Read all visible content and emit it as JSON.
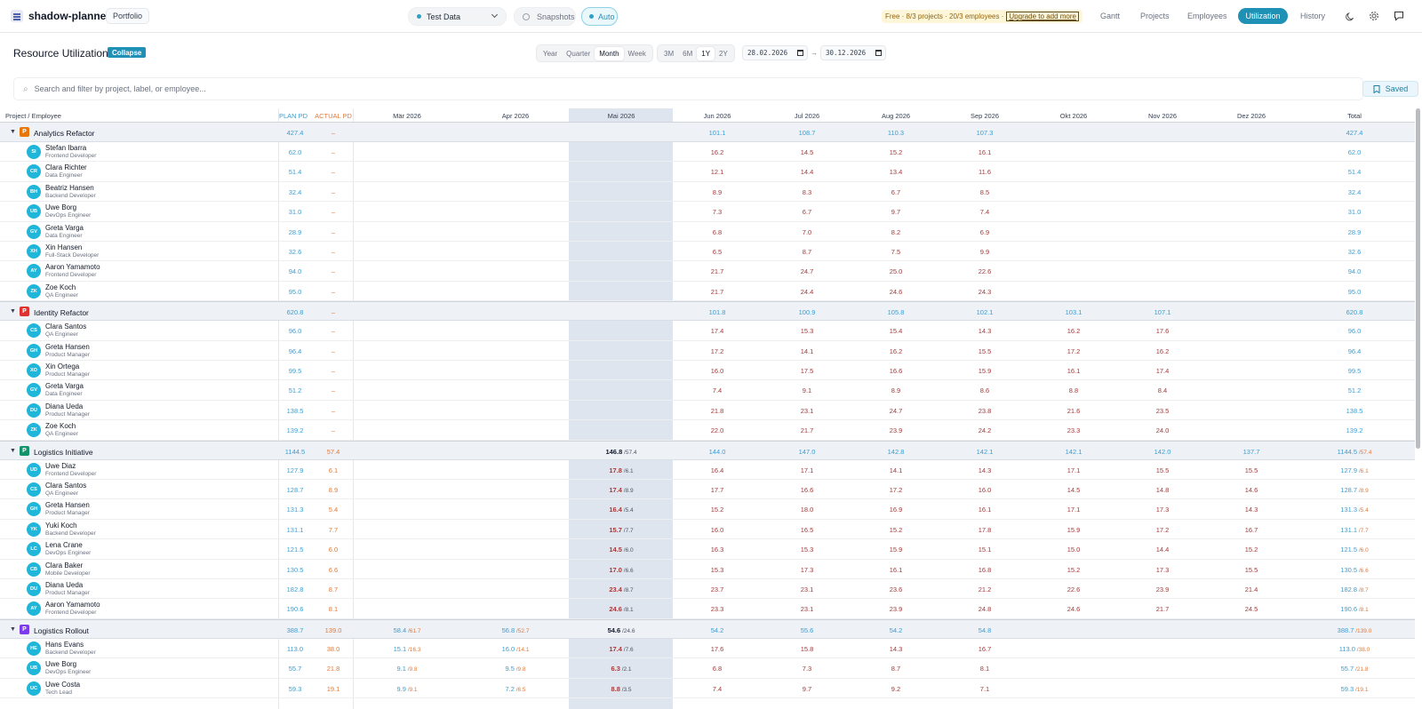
{
  "app": {
    "name": "shadow-planner",
    "portfolio_label": "Portfolio"
  },
  "topbar": {
    "dataset": "Test Data",
    "snapshots": "Snapshots",
    "auto": "Auto",
    "plan_notice": "Free · 8/3 projects · 20/3 employees ·",
    "upgrade": "Upgrade to add more",
    "nav": [
      "Gantt",
      "Projects",
      "Employees",
      "Utilization",
      "History"
    ],
    "active_nav": "Utilization"
  },
  "page": {
    "title": "Resource Utilization",
    "collapse": "Collapse",
    "granularity": [
      "Year",
      "Quarter",
      "Month",
      "Week"
    ],
    "granularity_active": "Month",
    "ranges": [
      "3M",
      "6M",
      "1Y",
      "2Y"
    ],
    "range_active": "1Y",
    "date_from": "28.02.2026",
    "date_to": "30.12.2026",
    "date_arrow": "→",
    "search_placeholder": "Search and filter by project, label, or employee...",
    "saved": "Saved"
  },
  "table": {
    "headers": {
      "name": "Project / Employee",
      "plan": "PLAN PD",
      "actual": "ACTUAL PD",
      "months": [
        "Mär 2026",
        "Apr 2026",
        "Mai 2026",
        "Jun 2026",
        "Jul 2026",
        "Aug 2026",
        "Sep 2026",
        "Okt 2026",
        "Nov 2026",
        "Dez 2026"
      ],
      "total": "Total"
    },
    "colors": {
      "analytics": "#e8760a",
      "identity": "#e03131",
      "logistics_init": "#12936a",
      "logistics_roll": "#7c3aed",
      "avatar": "#1fb6d9"
    },
    "projects": [
      {
        "name": "Analytics Refactor",
        "badge": "P",
        "color": "#e8760a",
        "plan": "427.4",
        "actual": "–",
        "months": [
          "",
          "",
          "",
          "101.1",
          "108.7",
          "110.3",
          "107.3",
          "",
          "",
          ""
        ],
        "total": "427.4",
        "total_actual": "",
        "employees": [
          {
            "initials": "SI",
            "name": "Stefan Ibarra",
            "role": "Frontend Developer",
            "plan": "62.0",
            "actual": "–",
            "months": [
              "",
              "",
              "",
              "16.2",
              "14.5",
              "15.2",
              "16.1",
              "",
              "",
              ""
            ],
            "total": "62.0",
            "total_actual": ""
          },
          {
            "initials": "CR",
            "name": "Clara Richter",
            "role": "Data Engineer",
            "plan": "51.4",
            "actual": "–",
            "months": [
              "",
              "",
              "",
              "12.1",
              "14.4",
              "13.4",
              "11.6",
              "",
              "",
              ""
            ],
            "total": "51.4",
            "total_actual": ""
          },
          {
            "initials": "BH",
            "name": "Beatriz Hansen",
            "role": "Backend Developer",
            "plan": "32.4",
            "actual": "–",
            "months": [
              "",
              "",
              "",
              "8.9",
              "8.3",
              "6.7",
              "8.5",
              "",
              "",
              ""
            ],
            "total": "32.4",
            "total_actual": ""
          },
          {
            "initials": "UB",
            "name": "Uwe Borg",
            "role": "DevOps Engineer",
            "plan": "31.0",
            "actual": "–",
            "months": [
              "",
              "",
              "",
              "7.3",
              "6.7",
              "9.7",
              "7.4",
              "",
              "",
              ""
            ],
            "total": "31.0",
            "total_actual": ""
          },
          {
            "initials": "GV",
            "name": "Greta Varga",
            "role": "Data Engineer",
            "plan": "28.9",
            "actual": "–",
            "months": [
              "",
              "",
              "",
              "6.8",
              "7.0",
              "8.2",
              "6.9",
              "",
              "",
              ""
            ],
            "total": "28.9",
            "total_actual": ""
          },
          {
            "initials": "XH",
            "name": "Xin Hansen",
            "role": "Full-Stack Developer",
            "plan": "32.6",
            "actual": "–",
            "months": [
              "",
              "",
              "",
              "6.5",
              "8.7",
              "7.5",
              "9.9",
              "",
              "",
              ""
            ],
            "total": "32.6",
            "total_actual": ""
          },
          {
            "initials": "AY",
            "name": "Aaron Yamamoto",
            "role": "Frontend Developer",
            "plan": "94.0",
            "actual": "–",
            "months": [
              "",
              "",
              "",
              "21.7",
              "24.7",
              "25.0",
              "22.6",
              "",
              "",
              ""
            ],
            "total": "94.0",
            "total_actual": ""
          },
          {
            "initials": "ZK",
            "name": "Zoe Koch",
            "role": "QA Engineer",
            "plan": "95.0",
            "actual": "–",
            "months": [
              "",
              "",
              "",
              "21.7",
              "24.4",
              "24.6",
              "24.3",
              "",
              "",
              ""
            ],
            "total": "95.0",
            "total_actual": ""
          }
        ]
      },
      {
        "name": "Identity Refactor",
        "badge": "P",
        "color": "#e03131",
        "plan": "620.8",
        "actual": "–",
        "months": [
          "",
          "",
          "",
          "101.8",
          "100.9",
          "105.8",
          "102.1",
          "103.1",
          "107.1",
          ""
        ],
        "total": "620.8",
        "total_actual": "",
        "employees": [
          {
            "initials": "CS",
            "name": "Clara Santos",
            "role": "QA Engineer",
            "plan": "96.0",
            "actual": "–",
            "months": [
              "",
              "",
              "",
              "17.4",
              "15.3",
              "15.4",
              "14.3",
              "16.2",
              "17.6",
              ""
            ],
            "total": "96.0",
            "total_actual": ""
          },
          {
            "initials": "GH",
            "name": "Greta Hansen",
            "role": "Product Manager",
            "plan": "96.4",
            "actual": "–",
            "months": [
              "",
              "",
              "",
              "17.2",
              "14.1",
              "16.2",
              "15.5",
              "17.2",
              "16.2",
              ""
            ],
            "total": "96.4",
            "total_actual": ""
          },
          {
            "initials": "XO",
            "name": "Xin Ortega",
            "role": "Product Manager",
            "plan": "99.5",
            "actual": "–",
            "months": [
              "",
              "",
              "",
              "16.0",
              "17.5",
              "16.6",
              "15.9",
              "16.1",
              "17.4",
              ""
            ],
            "total": "99.5",
            "total_actual": ""
          },
          {
            "initials": "GV",
            "name": "Greta Varga",
            "role": "Data Engineer",
            "plan": "51.2",
            "actual": "–",
            "months": [
              "",
              "",
              "",
              "7.4",
              "9.1",
              "8.9",
              "8.6",
              "8.8",
              "8.4",
              ""
            ],
            "total": "51.2",
            "total_actual": ""
          },
          {
            "initials": "DU",
            "name": "Diana Ueda",
            "role": "Product Manager",
            "plan": "138.5",
            "actual": "–",
            "months": [
              "",
              "",
              "",
              "21.8",
              "23.1",
              "24.7",
              "23.8",
              "21.6",
              "23.5",
              ""
            ],
            "total": "138.5",
            "total_actual": ""
          },
          {
            "initials": "ZK",
            "name": "Zoe Koch",
            "role": "QA Engineer",
            "plan": "139.2",
            "actual": "–",
            "months": [
              "",
              "",
              "",
              "22.0",
              "21.7",
              "23.9",
              "24.2",
              "23.3",
              "24.0",
              ""
            ],
            "total": "139.2",
            "total_actual": ""
          }
        ]
      },
      {
        "name": "Logistics Initiative",
        "badge": "P",
        "color": "#12936a",
        "plan": "1144.5",
        "actual": "57.4",
        "months": [
          "",
          "",
          "146.8|57.4",
          "144.0",
          "147.0",
          "142.8",
          "142.1",
          "142.1",
          "142.0",
          "137.7"
        ],
        "total": "1144.5",
        "total_actual": "57.4",
        "employees": [
          {
            "initials": "UD",
            "name": "Uwe Diaz",
            "role": "Frontend Developer",
            "plan": "127.9",
            "actual": "6.1",
            "months": [
              "",
              "",
              "17.8|6.1",
              "16.4",
              "17.1",
              "14.1",
              "14.3",
              "17.1",
              "15.5",
              "15.5"
            ],
            "total": "127.9",
            "total_actual": "6.1"
          },
          {
            "initials": "CS",
            "name": "Clara Santos",
            "role": "QA Engineer",
            "plan": "128.7",
            "actual": "8.9",
            "months": [
              "",
              "",
              "17.4|8.9",
              "17.7",
              "16.6",
              "17.2",
              "16.0",
              "14.5",
              "14.8",
              "14.6"
            ],
            "total": "128.7",
            "total_actual": "8.9"
          },
          {
            "initials": "GH",
            "name": "Greta Hansen",
            "role": "Product Manager",
            "plan": "131.3",
            "actual": "5.4",
            "months": [
              "",
              "",
              "16.4|5.4",
              "15.2",
              "18.0",
              "16.9",
              "16.1",
              "17.1",
              "17.3",
              "14.3"
            ],
            "total": "131.3",
            "total_actual": "5.4"
          },
          {
            "initials": "YK",
            "name": "Yuki Koch",
            "role": "Backend Developer",
            "plan": "131.1",
            "actual": "7.7",
            "months": [
              "",
              "",
              "15.7|7.7",
              "16.0",
              "16.5",
              "15.2",
              "17.8",
              "15.9",
              "17.2",
              "16.7"
            ],
            "total": "131.1",
            "total_actual": "7.7"
          },
          {
            "initials": "LC",
            "name": "Lena Crane",
            "role": "DevOps Engineer",
            "plan": "121.5",
            "actual": "6.0",
            "months": [
              "",
              "",
              "14.5|6.0",
              "16.3",
              "15.3",
              "15.9",
              "15.1",
              "15.0",
              "14.4",
              "15.2"
            ],
            "total": "121.5",
            "total_actual": "6.0"
          },
          {
            "initials": "CB",
            "name": "Clara Baker",
            "role": "Mobile Developer",
            "plan": "130.5",
            "actual": "6.6",
            "months": [
              "",
              "",
              "17.0|6.6",
              "15.3",
              "17.3",
              "16.1",
              "16.8",
              "15.2",
              "17.3",
              "15.5"
            ],
            "total": "130.5",
            "total_actual": "6.6"
          },
          {
            "initials": "DU",
            "name": "Diana Ueda",
            "role": "Product Manager",
            "plan": "182.8",
            "actual": "8.7",
            "months": [
              "",
              "",
              "23.4|8.7",
              "23.7",
              "23.1",
              "23.6",
              "21.2",
              "22.6",
              "23.9",
              "21.4"
            ],
            "total": "182.8",
            "total_actual": "8.7"
          },
          {
            "initials": "AY",
            "name": "Aaron Yamamoto",
            "role": "Frontend Developer",
            "plan": "190.6",
            "actual": "8.1",
            "months": [
              "",
              "",
              "24.6|8.1",
              "23.3",
              "23.1",
              "23.9",
              "24.8",
              "24.6",
              "21.7",
              "24.5"
            ],
            "total": "190.6",
            "total_actual": "8.1"
          }
        ]
      },
      {
        "name": "Logistics Rollout",
        "badge": "P",
        "color": "#7c3aed",
        "plan": "388.7",
        "actual": "139.0",
        "months": [
          "58.4|61.7",
          "56.8|52.7",
          "54.6|24.6",
          "54.2",
          "55.6",
          "54.2",
          "54.8",
          "",
          "",
          ""
        ],
        "total": "388.7",
        "total_actual": "139.0",
        "employees": [
          {
            "initials": "HE",
            "name": "Hans Evans",
            "role": "Backend Developer",
            "plan": "113.0",
            "actual": "38.0",
            "months": [
              "15.1|16.3",
              "16.0|14.1",
              "17.4|7.6",
              "17.6",
              "15.8",
              "14.3",
              "16.7",
              "",
              "",
              ""
            ],
            "total": "113.0",
            "total_actual": "38.0"
          },
          {
            "initials": "UB",
            "name": "Uwe Borg",
            "role": "DevOps Engineer",
            "plan": "55.7",
            "actual": "21.8",
            "months": [
              "9.1|9.8",
              "9.5|9.8",
              "6.3|2.1",
              "6.8",
              "7.3",
              "8.7",
              "8.1",
              "",
              "",
              ""
            ],
            "total": "55.7",
            "total_actual": "21.8"
          },
          {
            "initials": "UC",
            "name": "Uwe Costa",
            "role": "Tech Lead",
            "plan": "59.3",
            "actual": "19.1",
            "months": [
              "9.9|9.1",
              "7.2|6.5",
              "8.8|3.5",
              "7.4",
              "9.7",
              "9.2",
              "7.1",
              "",
              "",
              ""
            ],
            "total": "59.3",
            "total_actual": "19.1"
          }
        ]
      }
    ]
  }
}
